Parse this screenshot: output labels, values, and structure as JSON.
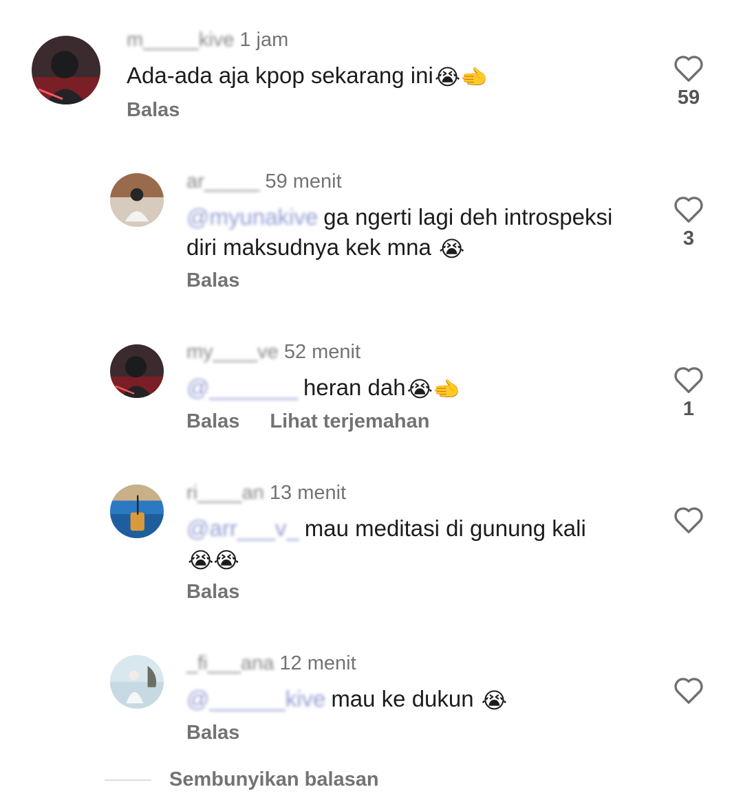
{
  "comments": [
    {
      "username": "m_____kive",
      "time": "1 jam",
      "mention": "",
      "text": "Ada-ada aja kpop sekarang ini",
      "emoji": "😭🫲",
      "actions": [
        "Balas"
      ],
      "likes": "59"
    },
    {
      "username": "ar_____",
      "time": "59 menit",
      "mention": "@myunakive",
      "text": "ga ngerti lagi deh introspeksi diri maksudnya kek mna",
      "emoji": "😭",
      "actions": [
        "Balas"
      ],
      "likes": "3"
    },
    {
      "username": "my____ve",
      "time": "52 menit",
      "mention": "@_______",
      "text": "heran dah",
      "emoji": "😭🫲",
      "actions": [
        "Balas",
        "Lihat terjemahan"
      ],
      "likes": "1"
    },
    {
      "username": "ri____an",
      "time": "13 menit",
      "mention": "@arr___v_",
      "text": "mau meditasi di gunung kali",
      "emoji": "😭😭",
      "actions": [
        "Balas"
      ],
      "likes": ""
    },
    {
      "username": "_fi___ana",
      "time": "12 menit",
      "mention": "@______kive",
      "text": "mau ke dukun",
      "emoji": "😭",
      "actions": [
        "Balas"
      ],
      "likes": ""
    }
  ],
  "hide_replies_label": "Sembunyikan balasan",
  "icons": {
    "like": "heart-outline-icon"
  }
}
